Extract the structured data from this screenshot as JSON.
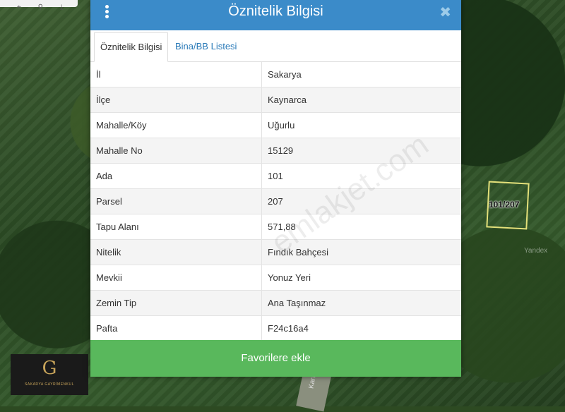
{
  "map": {
    "parcel_label": "101/207",
    "attribution": "Yandex",
    "road_label": "Karışık"
  },
  "dialog": {
    "title": "Öznitelik Bilgisi",
    "close_symbol": "✖",
    "tabs": [
      "Öznitelik Bilgisi",
      "Bina/BB Listesi"
    ],
    "rows": [
      {
        "key": "İl",
        "value": "Sakarya"
      },
      {
        "key": "İlçe",
        "value": "Kaynarca"
      },
      {
        "key": "Mahalle/Köy",
        "value": "Uğurlu"
      },
      {
        "key": "Mahalle No",
        "value": "15129"
      },
      {
        "key": "Ada",
        "value": "101"
      },
      {
        "key": "Parsel",
        "value": "207"
      },
      {
        "key": "Tapu Alanı",
        "value": "571,88"
      },
      {
        "key": "Nitelik",
        "value": "Fındık Bahçesi"
      },
      {
        "key": "Mevkii",
        "value": "Yonuz Yeri"
      },
      {
        "key": "Zemin Tip",
        "value": "Ana Taşınmaz"
      },
      {
        "key": "Pafta",
        "value": "F24c16a4"
      }
    ],
    "favorite_button": "Favorilere ekle",
    "watermark": "emlakjet.com"
  },
  "colors": {
    "header": "#3b8bc9",
    "button": "#59b85c"
  }
}
